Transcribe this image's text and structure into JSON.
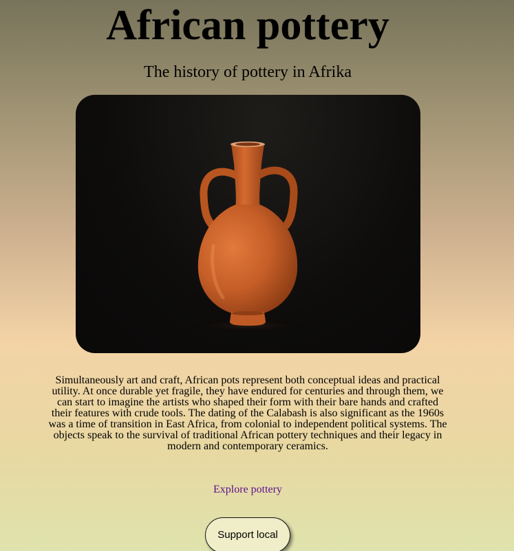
{
  "header": {
    "title": "African pottery",
    "subtitle": "The history of pottery in Afrika"
  },
  "hero": {
    "image": "terracotta-amphora-vase",
    "accent_color": "#c8622a",
    "background_color": "#0d0c0b"
  },
  "content": {
    "description": "Simultaneously art and craft, African pots represent both conceptual ideas and practical utility. At once durable yet fragile, they have endured for centuries and through them, we can start to imagine the artists who shaped their form with their bare hands and crafted their features with crude tools. The dating of the Calabash is also significant as the 1960s was a time of transition in East Africa, from colonial to independent political systems. The objects speak to the survival of traditional African pottery techniques and their legacy in modern and contemporary ceramics."
  },
  "links": {
    "explore_label": "Explore pottery",
    "link_color": "#5b1190"
  },
  "actions": {
    "support_label": "Support local"
  }
}
